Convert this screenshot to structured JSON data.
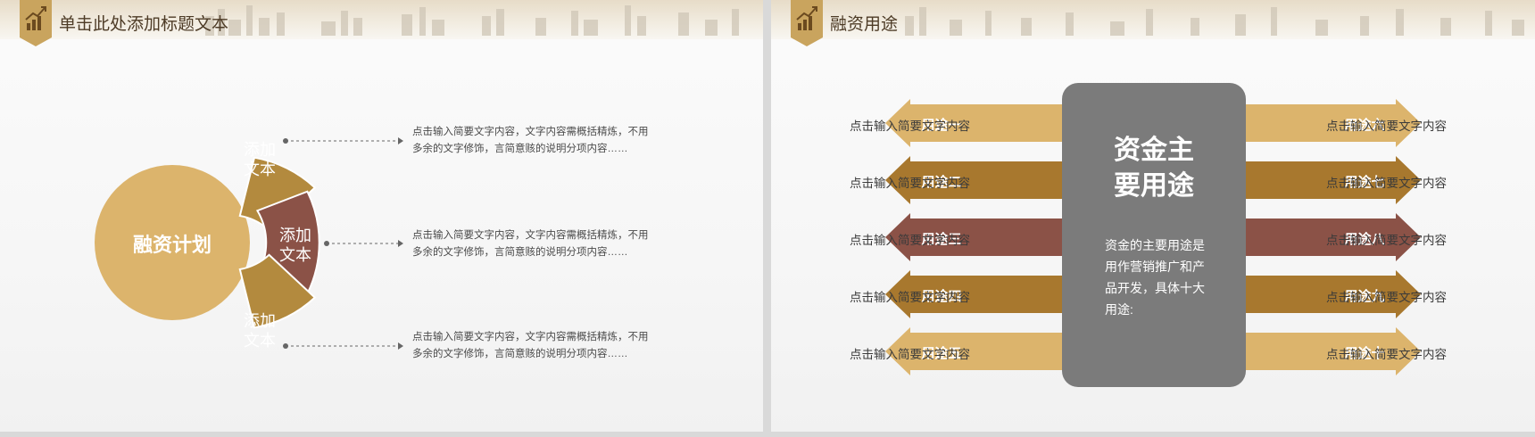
{
  "colors": {
    "gold": "#b38a3e",
    "light_gold": "#dcb46c",
    "red_brown": "#8b5247",
    "grey_panel": "#7b7b7b"
  },
  "slide1": {
    "title": "单击此处添加标题文本",
    "center_label": "融资计划",
    "segments": [
      {
        "label_line1": "添加",
        "label_line2": "文本"
      },
      {
        "label_line1": "添加",
        "label_line2": "文本"
      },
      {
        "label_line1": "添加",
        "label_line2": "文本"
      }
    ],
    "notes": [
      {
        "line1": "点击输入简要文字内容，文字内容需概括精炼，不用",
        "line2": "多余的文字修饰，言简意赅的说明分项内容……"
      },
      {
        "line1": "点击输入简要文字内容，文字内容需概括精炼，不用",
        "line2": "多余的文字修饰，言简意赅的说明分项内容……"
      },
      {
        "line1": "点击输入简要文字内容，文字内容需概括精炼，不用",
        "line2": "多余的文字修饰，言简意赅的说明分项内容……"
      }
    ]
  },
  "slide2": {
    "title": "融资用途",
    "panel_title_line1": "资金主",
    "panel_title_line2": "要用途",
    "panel_desc": "资金的主要用途是用作营销推广和产品开发，具体十大用途:",
    "left_items": [
      {
        "label": "用途一",
        "text": "点击输入简要文字内容"
      },
      {
        "label": "用途二",
        "text": "点击输入简要文字内容"
      },
      {
        "label": "用途三",
        "text": "点击输入简要文字内容"
      },
      {
        "label": "用途四",
        "text": "点击输入简要文字内容"
      },
      {
        "label": "用途五",
        "text": "点击输入简要文字内容"
      }
    ],
    "right_items": [
      {
        "label": "用途六",
        "text": "点击输入简要文字内容"
      },
      {
        "label": "用途七",
        "text": "点击输入简要文字内容"
      },
      {
        "label": "用途八",
        "text": "点击输入简要文字内容"
      },
      {
        "label": "用途九",
        "text": "点击输入简要文字内容"
      },
      {
        "label": "用途十",
        "text": "点击输入简要文字内容"
      }
    ]
  }
}
